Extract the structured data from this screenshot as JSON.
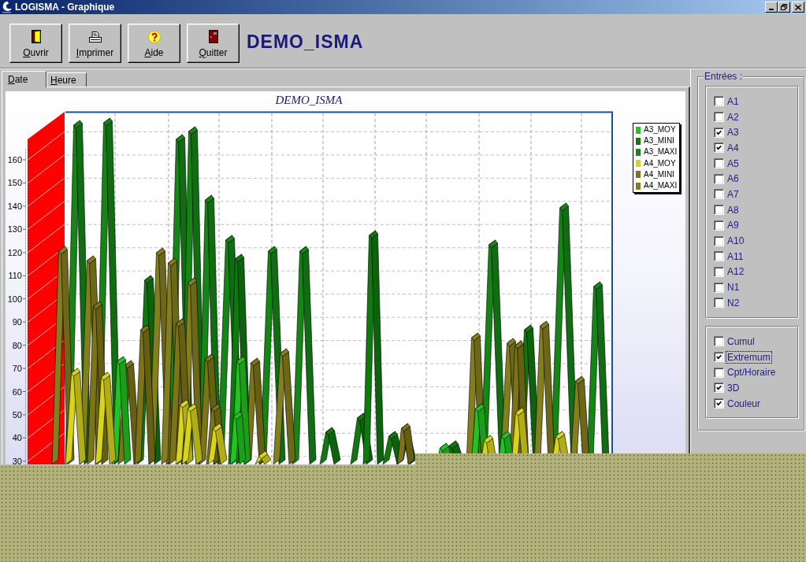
{
  "window": {
    "title": "LOGISMA - Graphique"
  },
  "toolbar": {
    "buttons": [
      {
        "label": "Ouvrir",
        "kind": "open"
      },
      {
        "label": "Imprimer",
        "kind": "print"
      },
      {
        "label": "Aide",
        "kind": "help"
      },
      {
        "label": "Quitter",
        "kind": "quit"
      }
    ],
    "heading": "DEMO_ISMA"
  },
  "tabs": [
    {
      "label": "Date",
      "selected": true
    },
    {
      "label": "Heure",
      "selected": false
    }
  ],
  "chart": {
    "title": "DEMO_ISMA",
    "y_axis_labels": [
      "160",
      "150",
      "140",
      "130",
      "120",
      "110",
      "100",
      "90",
      "80",
      "70",
      "60",
      "50",
      "40",
      "30"
    ],
    "legend": [
      {
        "label": "A3_MOY",
        "color": "#22c322"
      },
      {
        "label": "A3_MINI",
        "color": "#0e7a0e"
      },
      {
        "label": "A3_MAXI",
        "color": "#158515"
      },
      {
        "label": "A4_MOY",
        "color": "#d8d41c"
      },
      {
        "label": "A4_MINI",
        "color": "#7c7416"
      },
      {
        "label": "A4_MAXI",
        "color": "#857e1e"
      }
    ]
  },
  "inputs_panel": {
    "title": "Entrées :",
    "inputs": [
      {
        "label": "A1",
        "checked": false
      },
      {
        "label": "A2",
        "checked": false
      },
      {
        "label": "A3",
        "checked": true
      },
      {
        "label": "A4",
        "checked": true
      },
      {
        "label": "A5",
        "checked": false
      },
      {
        "label": "A6",
        "checked": false
      },
      {
        "label": "A7",
        "checked": false
      },
      {
        "label": "A8",
        "checked": false
      },
      {
        "label": "A9",
        "checked": false
      },
      {
        "label": "A10",
        "checked": false
      },
      {
        "label": "A11",
        "checked": false
      },
      {
        "label": "A12",
        "checked": false
      },
      {
        "label": "N1",
        "checked": false
      },
      {
        "label": "N2",
        "checked": false
      }
    ],
    "options": [
      {
        "label": "Cumul",
        "checked": false,
        "focused": false
      },
      {
        "label": "Extremum",
        "checked": true,
        "focused": true
      },
      {
        "label": "Cpt/Horaire",
        "checked": false,
        "focused": false
      },
      {
        "label": "3D",
        "checked": true,
        "focused": false
      },
      {
        "label": "Couleur",
        "checked": true,
        "focused": false
      }
    ]
  }
}
